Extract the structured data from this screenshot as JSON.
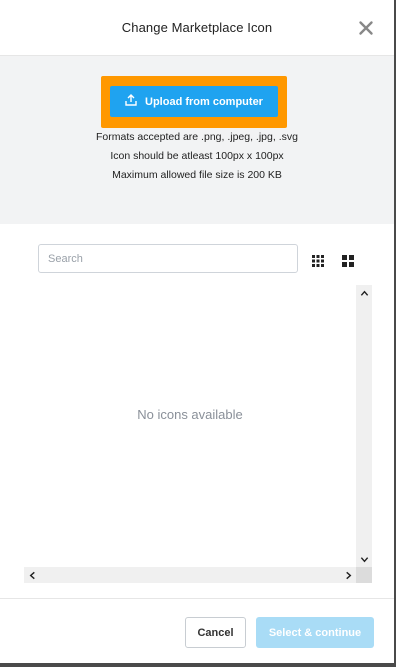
{
  "dialog": {
    "title": "Change Marketplace Icon"
  },
  "upload": {
    "button_label": "Upload from computer",
    "info": [
      "Formats accepted are .png, .jpeg, .jpg, .svg",
      "Icon should be atleast 100px x 100px",
      "Maximum allowed file size is 200 KB"
    ]
  },
  "search": {
    "placeholder": "Search",
    "value": ""
  },
  "view_toggles": [
    "grid-small-icon",
    "grid-large-icon"
  ],
  "icon_list": {
    "empty_message": "No icons available"
  },
  "footer": {
    "cancel_label": "Cancel",
    "select_label": "Select & continue"
  },
  "colors": {
    "highlight": "#ff9800",
    "primary": "#1fa3f0",
    "primary_disabled": "#a9dcf6",
    "panel_bg": "#f2f3f4"
  }
}
